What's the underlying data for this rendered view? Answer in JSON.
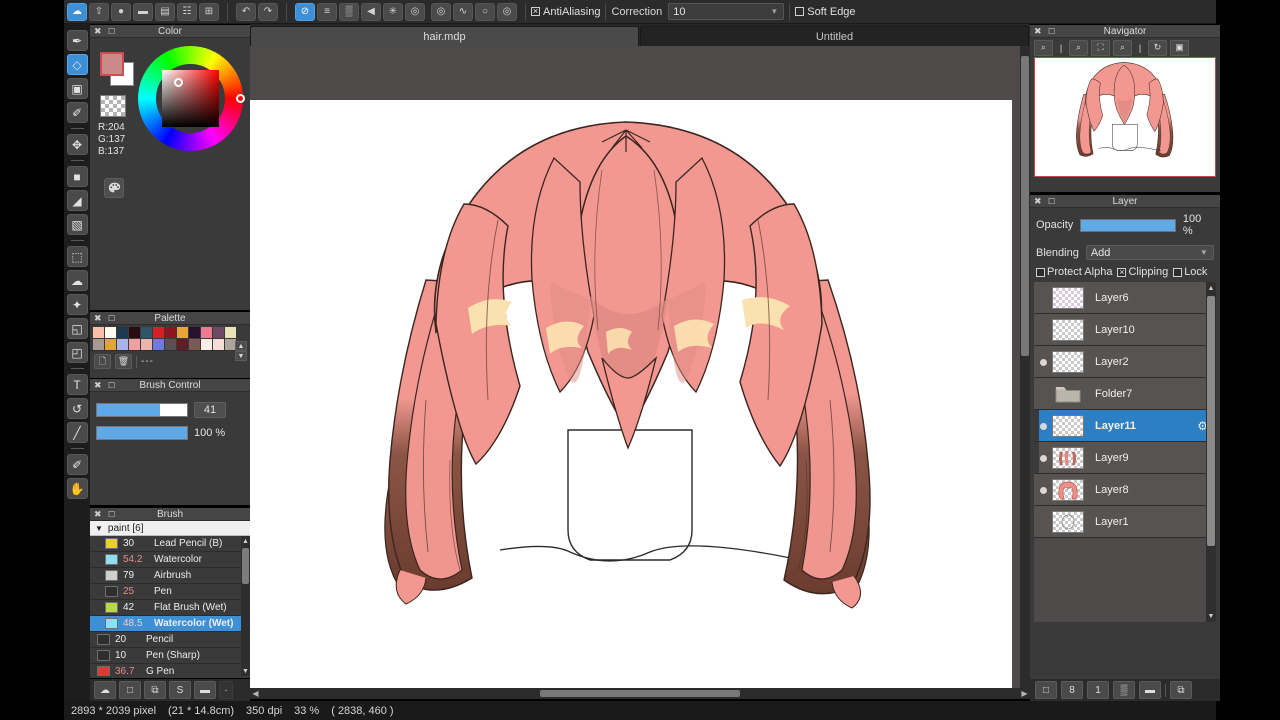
{
  "app": {
    "status": {
      "size": "2893 * 2039 pixel",
      "physical": "(21 * 14.8cm)",
      "dpi": "350 dpi",
      "zoom": "33 %",
      "coords": "( 2838, 460 )"
    }
  },
  "toolbar": {
    "group1": [
      {
        "name": "cloud-save-icon",
        "glyph": "☁",
        "active": true
      },
      {
        "name": "upload-icon",
        "glyph": "⇧"
      },
      {
        "name": "comment-bubble-icon",
        "glyph": "●"
      },
      {
        "name": "chat-icon",
        "glyph": "▬"
      },
      {
        "name": "document-icon",
        "glyph": "▤"
      },
      {
        "name": "list-panel-icon",
        "glyph": "☷"
      },
      {
        "name": "layout-icon",
        "glyph": "⊞"
      }
    ],
    "group2": [
      {
        "name": "undo-icon",
        "glyph": "↶"
      },
      {
        "name": "redo-icon",
        "glyph": "↷"
      }
    ],
    "group3": [
      {
        "name": "no-symmetry-icon",
        "glyph": "⊘",
        "active": true
      },
      {
        "name": "horizontal-lines-icon",
        "glyph": "≡"
      },
      {
        "name": "grid-icon",
        "glyph": "▒"
      },
      {
        "name": "angle-ruler-icon",
        "glyph": "◀"
      },
      {
        "name": "radial-symmetry-icon",
        "glyph": "✳"
      },
      {
        "name": "concentric-circle-icon",
        "glyph": "◎"
      }
    ],
    "group4": [
      {
        "name": "target-ruler-icon",
        "glyph": "◎"
      },
      {
        "name": "curve-ruler-icon",
        "glyph": "∿"
      },
      {
        "name": "circle-ruler-icon",
        "glyph": "○"
      },
      {
        "name": "ellipse-ruler-icon",
        "glyph": "◎"
      }
    ],
    "antialiasing_label": "AntiAliasing",
    "antialiasing_checked": true,
    "correction_label": "Correction",
    "correction_value": "10",
    "soft_edge_label": "Soft Edge",
    "soft_edge_checked": false
  },
  "tools": [
    {
      "name": "brush-tool",
      "glyph": "✒"
    },
    {
      "name": "eraser-tool",
      "glyph": "◇",
      "active": true
    },
    {
      "name": "select-rect-tool",
      "glyph": "▣"
    },
    {
      "name": "pen-tool",
      "glyph": "✐"
    },
    {
      "sep": true
    },
    {
      "name": "move-tool",
      "glyph": "✥"
    },
    {
      "sep": true
    },
    {
      "name": "fill-rect-tool",
      "glyph": "■"
    },
    {
      "name": "bucket-fill-tool",
      "glyph": "◢"
    },
    {
      "name": "gradient-tool",
      "glyph": "▧"
    },
    {
      "sep": true
    },
    {
      "name": "marquee-select-tool",
      "glyph": "⬚"
    },
    {
      "name": "lasso-select-tool",
      "glyph": "☁"
    },
    {
      "name": "magic-wand-tool",
      "glyph": "✦"
    },
    {
      "name": "select-edit-tool",
      "glyph": "◱"
    },
    {
      "name": "deselect-tool",
      "glyph": "◰"
    },
    {
      "sep": true
    },
    {
      "name": "text-tool",
      "glyph": "T"
    },
    {
      "name": "transform-tool",
      "glyph": "↺"
    },
    {
      "name": "eyedropper-tool",
      "glyph": "╱"
    },
    {
      "sep": true
    },
    {
      "name": "pencil-tool",
      "glyph": "✐"
    },
    {
      "name": "hand-tool",
      "glyph": "✋"
    }
  ],
  "color_panel": {
    "title": "Color",
    "r_label": "R:204",
    "g_label": "G:137",
    "b_label": "B:137",
    "foreground": "#cc8989",
    "background": "#ffffff"
  },
  "palette_panel": {
    "title": "Palette",
    "separator": "---",
    "row1": [
      "#f7c0a8",
      "#fdfaf0",
      "#1b3a52",
      "#2a0d10",
      "#2e5569",
      "#d81f25",
      "#8c1520",
      "#e8a63a",
      "#2a1030",
      "#f07890",
      "#6b4a63",
      "#ece2b8"
    ],
    "row2": [
      "#a79a92",
      "#e0a538",
      "#a9b3ea",
      "#f0a0a0",
      "#e8b6ae",
      "#6f7ae0",
      "#565252",
      "#5b1f2b",
      "#7a5a55",
      "#f7eee6",
      "#f4ddd2",
      "#ada49c"
    ]
  },
  "brush_control_panel": {
    "title": "Brush Control",
    "size_value": "41",
    "size_percent": 70,
    "opacity_value": "100 %",
    "opacity_percent": 100
  },
  "brush_panel": {
    "title": "Brush",
    "group_label": "paint [6]",
    "items": [
      {
        "color": "#e8d320",
        "num": "30",
        "name": "Lead Pencil (B)",
        "num_color": "#ececec",
        "indent": true
      },
      {
        "color": "#8fdff0",
        "num": "54.2",
        "name": "Watercolor",
        "num_color": "#e88b8b",
        "indent": true
      },
      {
        "color": "#cfcfcf",
        "num": "79",
        "name": "Airbrush",
        "num_color": "#ececec",
        "indent": true
      },
      {
        "color": "#2e2e2e",
        "num": "25",
        "name": "Pen",
        "num_color": "#e88b8b",
        "indent": true
      },
      {
        "color": "#b8d84a",
        "num": "42",
        "name": "Flat Brush (Wet)",
        "num_color": "#ececec",
        "indent": true
      },
      {
        "color": "#8fdff0",
        "num": "48.5",
        "name": "Watercolor (Wet)",
        "num_color": "#e88b8b",
        "indent": true,
        "selected": true
      },
      {
        "color": "#2e2e2e",
        "num": "20",
        "name": "Pencil",
        "num_color": "#ececec"
      },
      {
        "color": "#2e2e2e",
        "num": "10",
        "name": "Pen (Sharp)",
        "num_color": "#ececec"
      },
      {
        "color": "#e53535",
        "num": "36.7",
        "name": "G Pen",
        "num_color": "#e88b8b"
      }
    ],
    "bottom_buttons": [
      {
        "name": "brush-download-button",
        "glyph": "☁"
      },
      {
        "name": "brush-new-button",
        "glyph": "□"
      },
      {
        "name": "brush-duplicate-button",
        "glyph": "⧉"
      },
      {
        "name": "brush-settings-button",
        "glyph": "S"
      },
      {
        "name": "brush-folder-button",
        "glyph": "▬"
      }
    ]
  },
  "tabs": [
    {
      "label": "hair.mdp",
      "active": true
    },
    {
      "label": "Untitled",
      "active": false
    }
  ],
  "navigator_panel": {
    "title": "Navigator",
    "tools": [
      {
        "name": "zoom-reset-icon",
        "glyph": "⌕"
      },
      {
        "name": "zoom-in-icon",
        "glyph": "⌕"
      },
      {
        "name": "fit-screen-icon",
        "glyph": "⛶"
      },
      {
        "name": "zoom-out-icon",
        "glyph": "⌕"
      },
      {
        "name": "rotate-icon",
        "glyph": "↻"
      },
      {
        "name": "fit-window-icon",
        "glyph": "▣"
      }
    ]
  },
  "layer_panel": {
    "title": "Layer",
    "opacity_label": "Opacity",
    "opacity_value": "100 %",
    "blending_label": "Blending",
    "blending_value": "Add",
    "protect_alpha_label": "Protect Alpha",
    "protect_alpha_checked": false,
    "clipping_label": "Clipping",
    "clipping_checked": true,
    "lock_label": "Lock",
    "lock_checked": false,
    "layers": [
      {
        "name": "Layer6",
        "visible": false,
        "type": "layer",
        "thumb": "empty-tint",
        "selected": false,
        "clipped": false
      },
      {
        "name": "Layer10",
        "visible": false,
        "type": "layer",
        "thumb": "empty",
        "selected": false,
        "clipped": false
      },
      {
        "name": "Layer2",
        "visible": true,
        "type": "layer",
        "thumb": "empty",
        "selected": false,
        "clipped": false
      },
      {
        "name": "Folder7",
        "visible": false,
        "type": "folder",
        "thumb": "folder",
        "selected": false,
        "clipped": false
      },
      {
        "name": "Layer11",
        "visible": true,
        "type": "layer",
        "thumb": "empty",
        "selected": true,
        "clipped": true
      },
      {
        "name": "Layer9",
        "visible": true,
        "type": "layer",
        "thumb": "hair-small",
        "selected": false,
        "clipped": true
      },
      {
        "name": "Layer8",
        "visible": true,
        "type": "layer",
        "thumb": "hair-pink",
        "selected": false,
        "clipped": false
      },
      {
        "name": "Layer1",
        "visible": false,
        "type": "layer",
        "thumb": "sketch",
        "selected": false,
        "clipped": false
      }
    ],
    "bottom_buttons": [
      {
        "name": "new-layer-button",
        "glyph": "□"
      },
      {
        "name": "new-8bit-layer-button",
        "glyph": "8"
      },
      {
        "name": "new-1bit-layer-button",
        "glyph": "1"
      },
      {
        "name": "transparency-layer-button",
        "glyph": "▒"
      },
      {
        "name": "new-folder-button",
        "glyph": "▬"
      },
      {
        "name": "duplicate-layer-button",
        "glyph": "⧉"
      }
    ]
  },
  "artwork": {
    "hair_pink": "#f29891",
    "hair_pink_light": "#f7a9a0",
    "hair_brown": "#6f4236",
    "hair_brown_dark": "#5c3328",
    "highlight": "#fbe0b0",
    "outline": "#3a2520"
  }
}
